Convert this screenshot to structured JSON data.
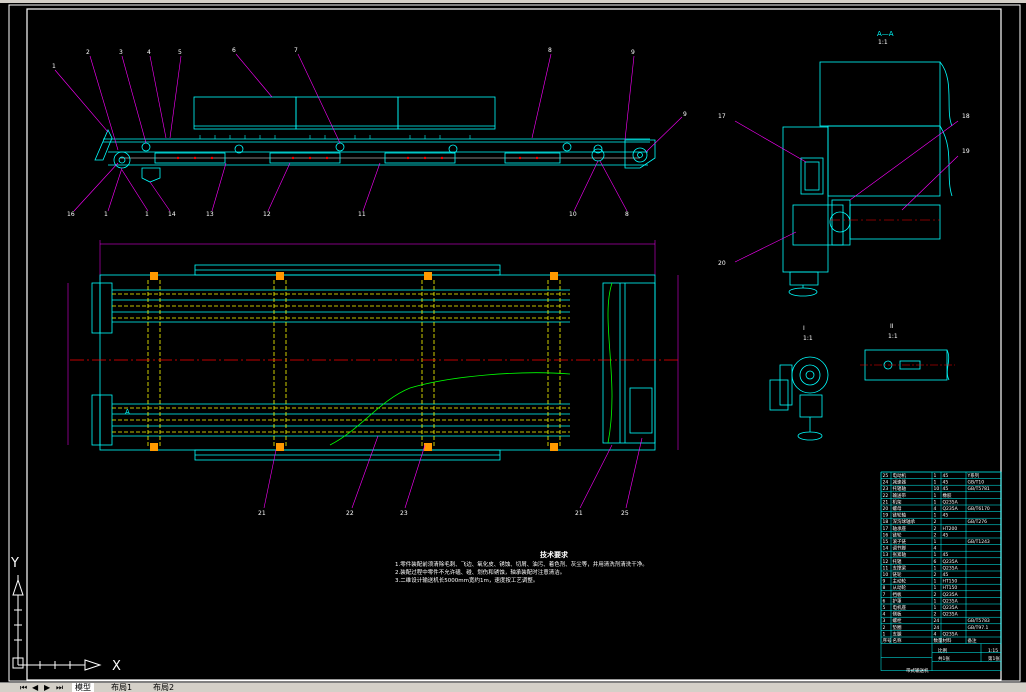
{
  "views": {
    "section_aa": {
      "title": "A—A",
      "scale": "1:1"
    },
    "detail_i": {
      "title": "I",
      "scale": "1:1"
    },
    "detail_ii": {
      "title": "II",
      "scale": "1:1"
    }
  },
  "side_view_balloons": [
    {
      "num": "1"
    },
    {
      "num": "2"
    },
    {
      "num": "3"
    },
    {
      "num": "4"
    },
    {
      "num": "5"
    },
    {
      "num": "6"
    },
    {
      "num": "7"
    },
    {
      "num": "8"
    },
    {
      "num": "9"
    },
    {
      "num": "16"
    },
    {
      "num": "1"
    },
    {
      "num": "14"
    },
    {
      "num": "13"
    },
    {
      "num": "12"
    },
    {
      "num": "11"
    },
    {
      "num": "10"
    },
    {
      "num": "8"
    }
  ],
  "section_balloons": [
    {
      "num": "17"
    },
    {
      "num": "18"
    },
    {
      "num": "19"
    },
    {
      "num": "20"
    }
  ],
  "plan_balloons": [
    {
      "num": "21"
    },
    {
      "num": "22"
    },
    {
      "num": "23"
    },
    {
      "num": "24"
    },
    {
      "num": "25"
    }
  ],
  "plan_section_mark": "A",
  "tech_notes": {
    "title": "技术要求",
    "lines": [
      "1.零件装配前须清除毛刺、飞边、氧化皮、锈蚀、切屑、油污、着色剂、灰尘等，并用清洗剂清洗干净。",
      "2.装配过程中零件不允许磕、碰、划伤和锈蚀，轴承装配时注意清洁。",
      "3.二维设计输送机长5000mm宽约1m，速度按工艺调整。"
    ]
  },
  "title_block": {
    "rows": [
      {
        "no": "25",
        "name": "电动机",
        "qty": "1",
        "mat": "45",
        "note": "Y系列"
      },
      {
        "no": "24",
        "name": "减速器",
        "qty": "1",
        "mat": "45",
        "note": "GB/T10"
      },
      {
        "no": "23",
        "name": "托辊轴",
        "qty": "10",
        "mat": "45",
        "note": "GB/T5781"
      },
      {
        "no": "22",
        "name": "输送带",
        "qty": "1",
        "mat": "橡胶",
        "note": ""
      },
      {
        "no": "21",
        "name": "机架",
        "qty": "1",
        "mat": "Q235A",
        "note": ""
      },
      {
        "no": "20",
        "name": "螺母",
        "qty": "4",
        "mat": "Q235A",
        "note": "GB/T6170"
      },
      {
        "no": "19",
        "name": "链轮轴",
        "qty": "1",
        "mat": "45",
        "note": ""
      },
      {
        "no": "18",
        "name": "深沟球轴承",
        "qty": "2",
        "mat": "",
        "note": "GB/T276"
      },
      {
        "no": "17",
        "name": "轴承座",
        "qty": "2",
        "mat": "HT200",
        "note": ""
      },
      {
        "no": "16",
        "name": "链轮",
        "qty": "2",
        "mat": "45",
        "note": ""
      },
      {
        "no": "15",
        "name": "滚子链",
        "qty": "1",
        "mat": "",
        "note": "GB/T1243"
      },
      {
        "no": "14",
        "name": "调节脚",
        "qty": "4",
        "mat": "",
        "note": ""
      },
      {
        "no": "13",
        "name": "张紧轴",
        "qty": "1",
        "mat": "45",
        "note": ""
      },
      {
        "no": "12",
        "name": "托辊",
        "qty": "6",
        "mat": "Q235A",
        "note": ""
      },
      {
        "no": "11",
        "name": "支撑梁",
        "qty": "1",
        "mat": "Q235A",
        "note": ""
      },
      {
        "no": "10",
        "name": "链轮",
        "qty": "2",
        "mat": "45",
        "note": ""
      },
      {
        "no": "9",
        "name": "主动轮",
        "qty": "1",
        "mat": "HT150",
        "note": ""
      },
      {
        "no": "8",
        "name": "从动轮",
        "qty": "1",
        "mat": "HT150",
        "note": ""
      },
      {
        "no": "7",
        "name": "挡板",
        "qty": "2",
        "mat": "Q235A",
        "note": ""
      },
      {
        "no": "6",
        "name": "护罩",
        "qty": "1",
        "mat": "Q235A",
        "note": ""
      },
      {
        "no": "5",
        "name": "电机座",
        "qty": "1",
        "mat": "Q235A",
        "note": ""
      },
      {
        "no": "4",
        "name": "侧板",
        "qty": "2",
        "mat": "Q235A",
        "note": ""
      },
      {
        "no": "3",
        "name": "螺栓",
        "qty": "24",
        "mat": "",
        "note": "GB/T5783"
      },
      {
        "no": "2",
        "name": "垫圈",
        "qty": "24",
        "mat": "",
        "note": "GB/T97.1"
      },
      {
        "no": "1",
        "name": "支腿",
        "qty": "4",
        "mat": "Q235A",
        "note": ""
      }
    ],
    "header": {
      "no": "序号",
      "name": "名称",
      "qty": "数量",
      "mat": "材料",
      "note": "备注"
    },
    "drawing_name": "带式输送机",
    "scale_label": "比例",
    "scale_value": "1:15",
    "sheet_label": "共1张",
    "sheet_value": "第1张"
  },
  "ucs": {
    "x_label": "X",
    "y_label": "Y"
  },
  "layout_tabs": {
    "items": [
      {
        "label": "模型"
      },
      {
        "label": "布局1"
      },
      {
        "label": "布局2"
      }
    ],
    "active": "模型"
  },
  "colors": {
    "background": "#000000",
    "frame": "#ffffff",
    "geometry": "#00ffff",
    "leader": "#ff00ff",
    "hidden": "#ffff00",
    "centerline": "#ff0000",
    "section_line": "#00ff00"
  }
}
